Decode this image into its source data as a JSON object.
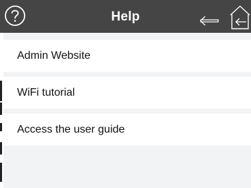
{
  "header": {
    "title": "Help",
    "help_icon": "help-circle-icon",
    "back_icon": "back-arrow-icon",
    "home_icon": "home-icon",
    "background_color": "#454545",
    "icon_color": "#ffffff"
  },
  "menu": {
    "items": [
      {
        "label": "Admin Website"
      },
      {
        "label": "WiFi tutorial"
      },
      {
        "label": "Access the user guide"
      }
    ]
  },
  "colors": {
    "content_background": "#f2f3f4",
    "item_background": "#ffffff",
    "text": "#111111"
  }
}
